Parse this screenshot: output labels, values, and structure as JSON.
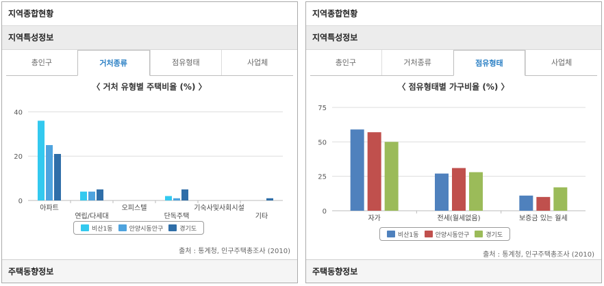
{
  "left": {
    "header": "지역종합현황",
    "subheader": "지역특성정보",
    "tabs": [
      "총인구",
      "거처종류",
      "점유형태",
      "사업체"
    ],
    "active_tab": 1,
    "source": "출처 : 통계청, 인구주택총조사 (2010)",
    "footer": "주택동향정보"
  },
  "right": {
    "header": "지역종합현황",
    "subheader": "지역특성정보",
    "tabs": [
      "총인구",
      "거처종류",
      "점유형태",
      "사업체"
    ],
    "active_tab": 2,
    "source": "출처 : 통계청, 인구주택총조사 (2010)",
    "footer": "주택동향정보"
  },
  "chart_data": [
    {
      "type": "bar",
      "title": "〈 거처 유형별 주택비율 (%) 〉",
      "categories": [
        "아파트",
        "연립/다세대",
        "오피스텔",
        "단독주택",
        "기숙사및사회시설",
        "기타"
      ],
      "series": [
        {
          "name": "비산1동",
          "color": "#33c9ef",
          "values": [
            36,
            4,
            0,
            2,
            0,
            0
          ]
        },
        {
          "name": "안양시동안구",
          "color": "#4ea3de",
          "values": [
            25,
            4,
            0,
            1,
            0,
            0
          ]
        },
        {
          "name": "경기도",
          "color": "#2f6ea8",
          "values": [
            21,
            5,
            0,
            5,
            0,
            1
          ]
        }
      ],
      "yticks": [
        0,
        20,
        40
      ],
      "ylim": [
        0,
        42
      ],
      "grid": true,
      "legend_position": "bottom"
    },
    {
      "type": "bar",
      "title": "〈 점유형태별 가구비율 (%) 〉",
      "categories": [
        "자가",
        "전세(월세없음)",
        "보증금 있는 월세"
      ],
      "series": [
        {
          "name": "비산1동",
          "color": "#4f81bd",
          "values": [
            59,
            27,
            11
          ]
        },
        {
          "name": "안양시동안구",
          "color": "#c0504d",
          "values": [
            57,
            31,
            10
          ]
        },
        {
          "name": "경기도",
          "color": "#9bbb59",
          "values": [
            50,
            28,
            17
          ]
        }
      ],
      "yticks": [
        0,
        25,
        50,
        75
      ],
      "ylim": [
        0,
        75
      ],
      "grid": true,
      "legend_position": "bottom"
    }
  ]
}
